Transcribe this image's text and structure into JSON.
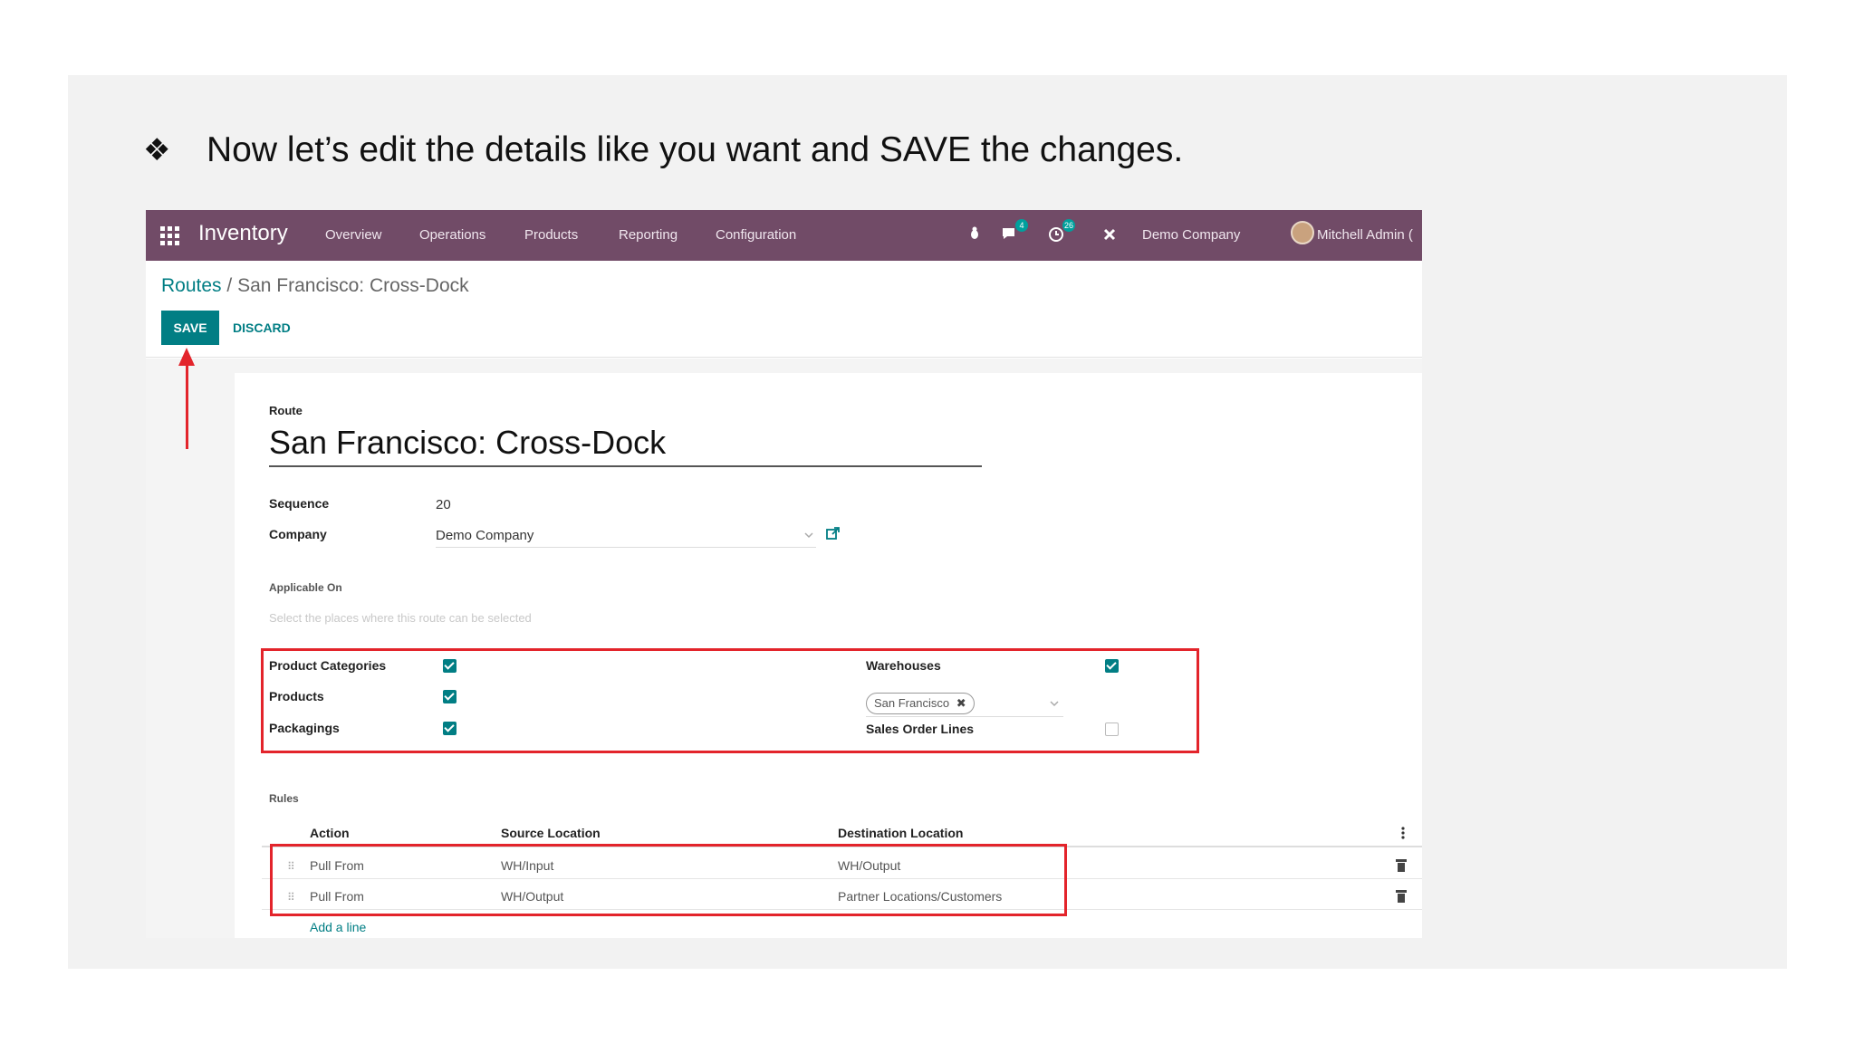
{
  "slide": {
    "bullet": "❖",
    "instruction": "Now let’s edit the details like you want and SAVE the changes."
  },
  "topbar": {
    "app_name": "Inventory",
    "menu": [
      "Overview",
      "Operations",
      "Products",
      "Reporting",
      "Configuration"
    ],
    "messages_count": "4",
    "activities_count": "26",
    "company": "Demo Company",
    "user": "Mitchell Admin ("
  },
  "breadcrumb": {
    "parent": "Routes",
    "separator": " / ",
    "current": "San Francisco: Cross-Dock"
  },
  "actions": {
    "save_label": "SAVE",
    "discard_label": "DISCARD"
  },
  "form": {
    "route_label": "Route",
    "route_name": "San Francisco: Cross-Dock",
    "sequence_label": "Sequence",
    "sequence_value": "20",
    "company_label": "Company",
    "company_value": "Demo Company",
    "applicable_label": "Applicable On",
    "applicable_hint": "Select the places where this route can be selected",
    "product_categories_label": "Product Categories",
    "product_categories_checked": true,
    "products_label": "Products",
    "products_checked": true,
    "packagings_label": "Packagings",
    "packagings_checked": true,
    "warehouses_label": "Warehouses",
    "warehouses_checked": true,
    "warehouse_tag": "San Francisco",
    "sales_order_lines_label": "Sales Order Lines",
    "sales_order_lines_checked": false
  },
  "rules": {
    "section_label": "Rules",
    "columns": [
      "Action",
      "Source Location",
      "Destination Location"
    ],
    "rows": [
      {
        "action": "Pull From",
        "source": "WH/Input",
        "destination": "WH/Output"
      },
      {
        "action": "Pull From",
        "source": "WH/Output",
        "destination": "Partner Locations/Customers"
      }
    ],
    "add_line": "Add a line"
  },
  "colors": {
    "navbar": "#714b67",
    "primary": "#017e84",
    "highlight": "#e3242b"
  }
}
